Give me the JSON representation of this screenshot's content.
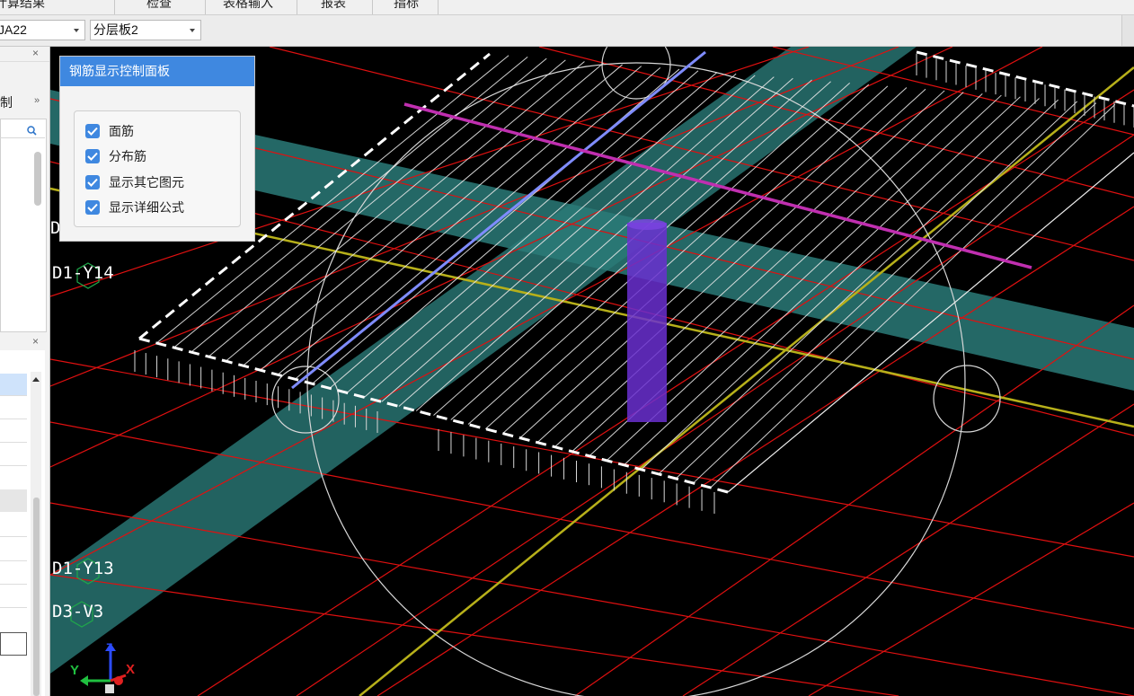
{
  "menu": {
    "items": [
      "计算结果",
      "检查",
      "表格输入",
      "报表",
      "指标"
    ]
  },
  "toolbar": {
    "combo1": "JA22",
    "combo2": "分层板2"
  },
  "left_panel": {
    "label_top": "制",
    "close": "×",
    "close2": "×",
    "more": "»"
  },
  "axis_labels": {
    "d1_y14": "D1-Y14",
    "d1_y13": "D1-Y13",
    "d3_v3": "D3-V3",
    "d_partial": "D"
  },
  "triad": {
    "x": "X",
    "y": "Y",
    "z": "Z"
  },
  "control_panel": {
    "title": "钢筋显示控制面板",
    "options": [
      {
        "label": "面筋",
        "checked": true
      },
      {
        "label": "分布筋",
        "checked": true
      },
      {
        "label": "显示其它图元",
        "checked": true
      },
      {
        "label": "显示详细公式",
        "checked": true
      }
    ]
  },
  "colors": {
    "accent": "#3f88e0",
    "grid_red": "#e01010",
    "teal_beam": "#2a7a78",
    "yellow_axis": "#b7b01a",
    "magenta_rebar": "#c02fb0",
    "purple_column": "#6a2fd0"
  }
}
